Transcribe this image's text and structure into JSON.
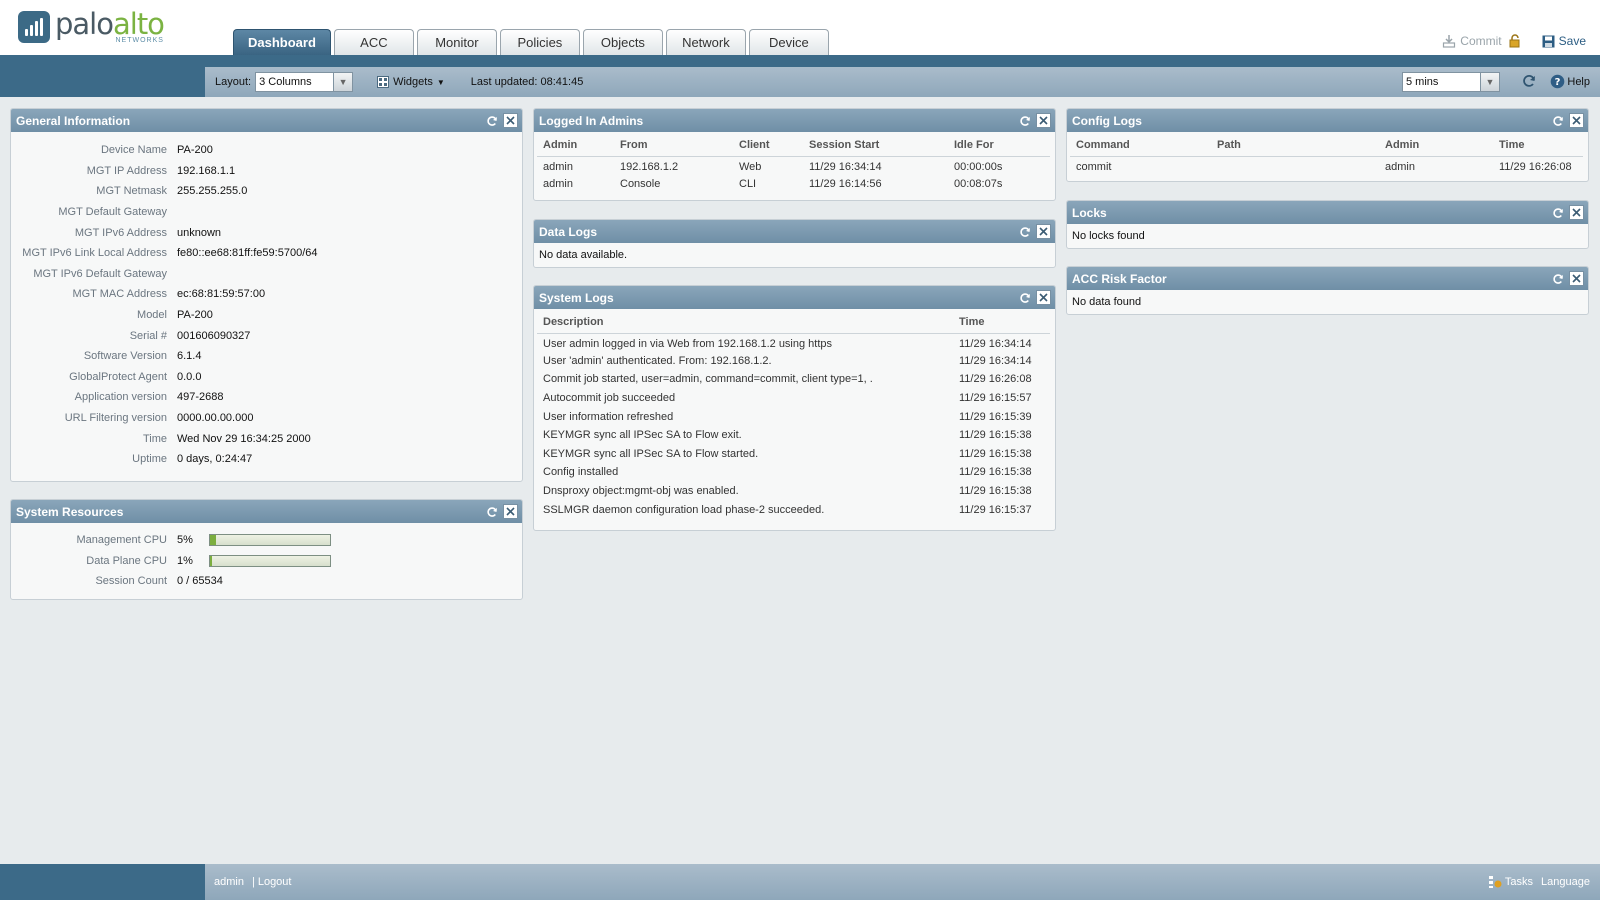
{
  "brand": {
    "name_a": "palo",
    "name_b": "alto",
    "sub": "NETWORKS"
  },
  "tabs": [
    {
      "label": "Dashboard",
      "active": true
    },
    {
      "label": "ACC"
    },
    {
      "label": "Monitor"
    },
    {
      "label": "Policies"
    },
    {
      "label": "Objects"
    },
    {
      "label": "Network"
    },
    {
      "label": "Device"
    }
  ],
  "header": {
    "commit_label": "Commit",
    "save_label": "Save"
  },
  "toolbar": {
    "layout_label": "Layout:",
    "layout_value": "3 Columns",
    "widgets_label": "Widgets",
    "last_updated": "Last updated: 08:41:45",
    "refresh_value": "5 mins",
    "help_label": "Help"
  },
  "general_info": {
    "title": "General Information",
    "rows": [
      {
        "k": "Device Name",
        "v": "PA-200"
      },
      {
        "k": "MGT IP Address",
        "v": "192.168.1.1"
      },
      {
        "k": "MGT Netmask",
        "v": "255.255.255.0"
      },
      {
        "k": "MGT Default Gateway",
        "v": ""
      },
      {
        "k": "MGT IPv6 Address",
        "v": "unknown"
      },
      {
        "k": "MGT IPv6 Link Local Address",
        "v": "fe80::ee68:81ff:fe59:5700/64"
      },
      {
        "k": "MGT IPv6 Default Gateway",
        "v": ""
      },
      {
        "k": "MGT MAC Address",
        "v": "ec:68:81:59:57:00"
      },
      {
        "k": "Model",
        "v": "PA-200"
      },
      {
        "k": "Serial #",
        "v": "001606090327"
      },
      {
        "k": "Software Version",
        "v": "6.1.4"
      },
      {
        "k": "GlobalProtect Agent",
        "v": "0.0.0"
      },
      {
        "k": "Application version",
        "v": "497-2688"
      },
      {
        "k": "URL Filtering version",
        "v": "0000.00.00.000"
      },
      {
        "k": "Time",
        "v": "Wed Nov 29 16:34:25 2000"
      },
      {
        "k": "Uptime",
        "v": "0 days, 0:24:47"
      }
    ]
  },
  "system_resources": {
    "title": "System Resources",
    "mgmt_cpu_label": "Management CPU",
    "mgmt_cpu_value": "5%",
    "mgmt_cpu_fraction": 0.05,
    "dp_cpu_label": "Data Plane CPU",
    "dp_cpu_value": "1%",
    "dp_cpu_fraction": 0.01,
    "session_label": "Session Count",
    "session_value": "0 / 65534"
  },
  "logged_admins": {
    "title": "Logged In Admins",
    "columns": [
      "Admin",
      "From",
      "Client",
      "Session Start",
      "Idle For"
    ],
    "rows": [
      [
        "admin",
        "192.168.1.2",
        "Web",
        "11/29 16:34:14",
        "00:00:00s"
      ],
      [
        "admin",
        "Console",
        "CLI",
        "11/29 16:14:56",
        "00:08:07s"
      ]
    ]
  },
  "data_logs": {
    "title": "Data Logs",
    "message": "No data available."
  },
  "system_logs": {
    "title": "System Logs",
    "columns": [
      "Description",
      "Time"
    ],
    "rows": [
      [
        "User admin logged in via Web from 192.168.1.2 using https",
        "11/29 16:34:14"
      ],
      [
        "User 'admin' authenticated. From: 192.168.1.2.",
        "11/29 16:34:14"
      ],
      [
        "Commit job started, user=admin, command=commit, client type=1, .",
        "11/29 16:26:08"
      ],
      [
        "Autocommit job succeeded",
        "11/29 16:15:57"
      ],
      [
        "User information refreshed",
        "11/29 16:15:39"
      ],
      [
        "KEYMGR sync all IPSec SA to Flow exit.",
        "11/29 16:15:38"
      ],
      [
        "KEYMGR sync all IPSec SA to Flow started.",
        "11/29 16:15:38"
      ],
      [
        "Config installed",
        "11/29 16:15:38"
      ],
      [
        "Dnsproxy object:mgmt-obj was enabled.",
        "11/29 16:15:38"
      ],
      [
        "SSLMGR daemon configuration load phase-2 succeeded.",
        "11/29 16:15:37"
      ]
    ]
  },
  "config_logs": {
    "title": "Config Logs",
    "columns": [
      "Command",
      "Path",
      "Admin",
      "Time"
    ],
    "rows": [
      [
        "commit",
        "",
        "admin",
        "11/29 16:26:08"
      ]
    ]
  },
  "locks": {
    "title": "Locks",
    "message": "No locks found"
  },
  "acc_risk": {
    "title": "ACC Risk Factor",
    "message": "No data found"
  },
  "footer": {
    "user": "admin",
    "separator": "|",
    "logout": "Logout",
    "tasks": "Tasks",
    "language": "Language"
  },
  "colors": {
    "accent": "#3c6a88",
    "panel_header": "#7a98ad",
    "logo_green": "#7bb342",
    "cpu_fill": "#7cae3f"
  }
}
